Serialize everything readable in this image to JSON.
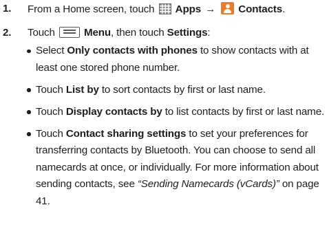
{
  "steps": [
    {
      "number": "1.",
      "from_home": "From a Home screen, touch",
      "apps_icon": "apps-grid-icon",
      "apps": "Apps",
      "arrow": "→",
      "contacts_icon": "contacts-icon",
      "contacts": "Contacts",
      "end": "."
    },
    {
      "number": "2.",
      "touch": "Touch",
      "menu_icon": "menu-icon",
      "menu": "Menu",
      "then": ", then touch",
      "settings": "Settings",
      "end": ":"
    }
  ],
  "bullets": [
    {
      "before": "Select ",
      "bold": "Only contacts with phones",
      "after": " to show contacts with at least one stored phone number."
    },
    {
      "before": "Touch ",
      "bold": "List by",
      "after": " to sort contacts by first or last name."
    },
    {
      "before": "Touch ",
      "bold": "Display contacts by",
      "after": " to list contacts by first or last name."
    },
    {
      "before": "Touch ",
      "bold": "Contact sharing settings",
      "after": " to set your preferences for transferring contacts by Bluetooth. You can choose to send all namecards at once, or individually. For more information about sending contacts, see ",
      "italic": "“Sending Namecards (vCards)”",
      "tail": " on page 41."
    }
  ],
  "colors": {
    "text": "#1e1e1e",
    "contacts_icon": "#f07a26",
    "apps_icon": "#8a8a8a"
  }
}
